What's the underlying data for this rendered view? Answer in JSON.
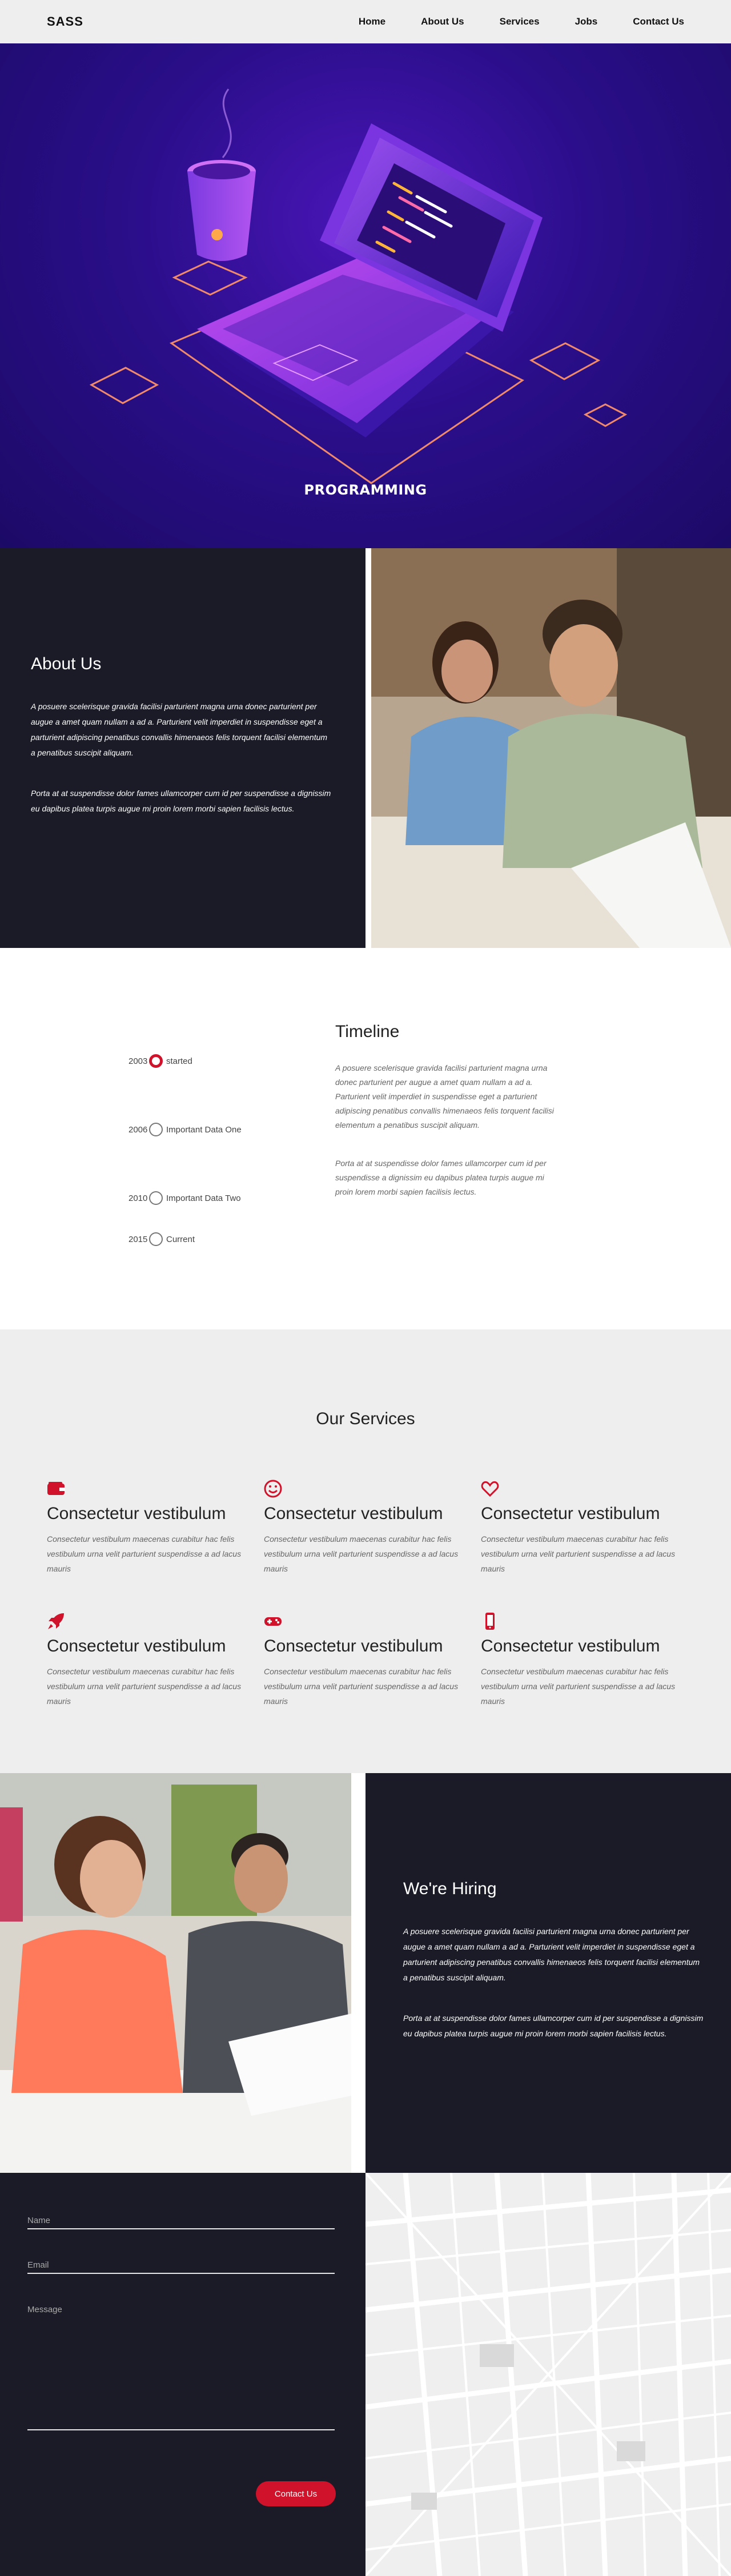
{
  "nav": {
    "brand": "SASS",
    "links": [
      "Home",
      "About Us",
      "Services",
      "Jobs",
      "Contact Us"
    ]
  },
  "hero": {
    "title": "PROGRAMMING"
  },
  "about": {
    "title": "About Us",
    "para1": "A posuere scelerisque gravida facilisi parturient magna urna donec parturient per augue a amet quam nullam a ad a. Parturient velit imperdiet in suspendisse eget a parturient adipiscing penatibus convallis himenaeos felis torquent facilisi elementum a penatibus suscipit aliquam.",
    "para2": "Porta at at suspendisse dolor fames ullamcorper cum id per suspendisse a dignissim eu dapibus platea turpis augue mi proin lorem morbi sapien facilisis lectus."
  },
  "timeline": {
    "title": "Timeline",
    "items": [
      {
        "year": "2003",
        "label": "started"
      },
      {
        "year": "2006",
        "label": "Important Data One"
      },
      {
        "year": "2010",
        "label": "Important Data Two"
      },
      {
        "year": "2015",
        "label": "Current"
      }
    ],
    "para1": "A posuere scelerisque gravida facilisi parturient magna urna donec parturient per augue a amet quam nullam a ad a. Parturient velit imperdiet in suspendisse eget a parturient adipiscing penatibus convallis himenaeos felis torquent facilisi elementum a penatibus suscipit aliquam.",
    "para2": "Porta at at suspendisse dolor fames ullamcorper cum id per suspendisse a dignissim eu dapibus platea turpis augue mi proin lorem morbi sapien facilisis lectus."
  },
  "services": {
    "title": "Our Services",
    "items": [
      {
        "icon": "wallet-icon",
        "heading": "Consectetur vestibulum",
        "text": "Consectetur vestibulum maecenas curabitur hac felis vestibulum urna velit parturient suspendisse a ad lacus mauris"
      },
      {
        "icon": "smile-icon",
        "heading": "Consectetur vestibulum",
        "text": "Consectetur vestibulum maecenas curabitur hac felis vestibulum urna velit parturient suspendisse a ad lacus mauris"
      },
      {
        "icon": "heart-icon",
        "heading": "Consectetur vestibulum",
        "text": "Consectetur vestibulum maecenas curabitur hac felis vestibulum urna velit parturient suspendisse a ad lacus mauris"
      },
      {
        "icon": "rocket-icon",
        "heading": "Consectetur vestibulum",
        "text": "Consectetur vestibulum maecenas curabitur hac felis vestibulum urna velit parturient suspendisse a ad lacus mauris"
      },
      {
        "icon": "gamepad-icon",
        "heading": "Consectetur vestibulum",
        "text": "Consectetur vestibulum maecenas curabitur hac felis vestibulum urna velit parturient suspendisse a ad lacus mauris"
      },
      {
        "icon": "mobile-icon",
        "heading": "Consectetur vestibulum",
        "text": "Consectetur vestibulum maecenas curabitur hac felis vestibulum urna velit parturient suspendisse a ad lacus mauris"
      }
    ]
  },
  "hiring": {
    "title": "We're Hiring",
    "para1": "A posuere scelerisque gravida facilisi parturient magna urna donec parturient per augue a amet quam nullam a ad a. Parturient velit imperdiet in suspendisse eget a parturient adipiscing penatibus convallis himenaeos felis torquent facilisi elementum a penatibus suscipit aliquam.",
    "para2": "Porta at at suspendisse dolor fames ullamcorper cum id per suspendisse a dignissim eu dapibus platea turpis augue mi proin lorem morbi sapien facilisis lectus."
  },
  "contact": {
    "name_placeholder": "Name",
    "email_placeholder": "Email",
    "message_placeholder": "Message",
    "button_label": "Contact Us"
  },
  "colors": {
    "accent": "#d0132b",
    "dark": "#1a1b26",
    "hero": "#2a0e8a",
    "light": "#eeeeee"
  }
}
